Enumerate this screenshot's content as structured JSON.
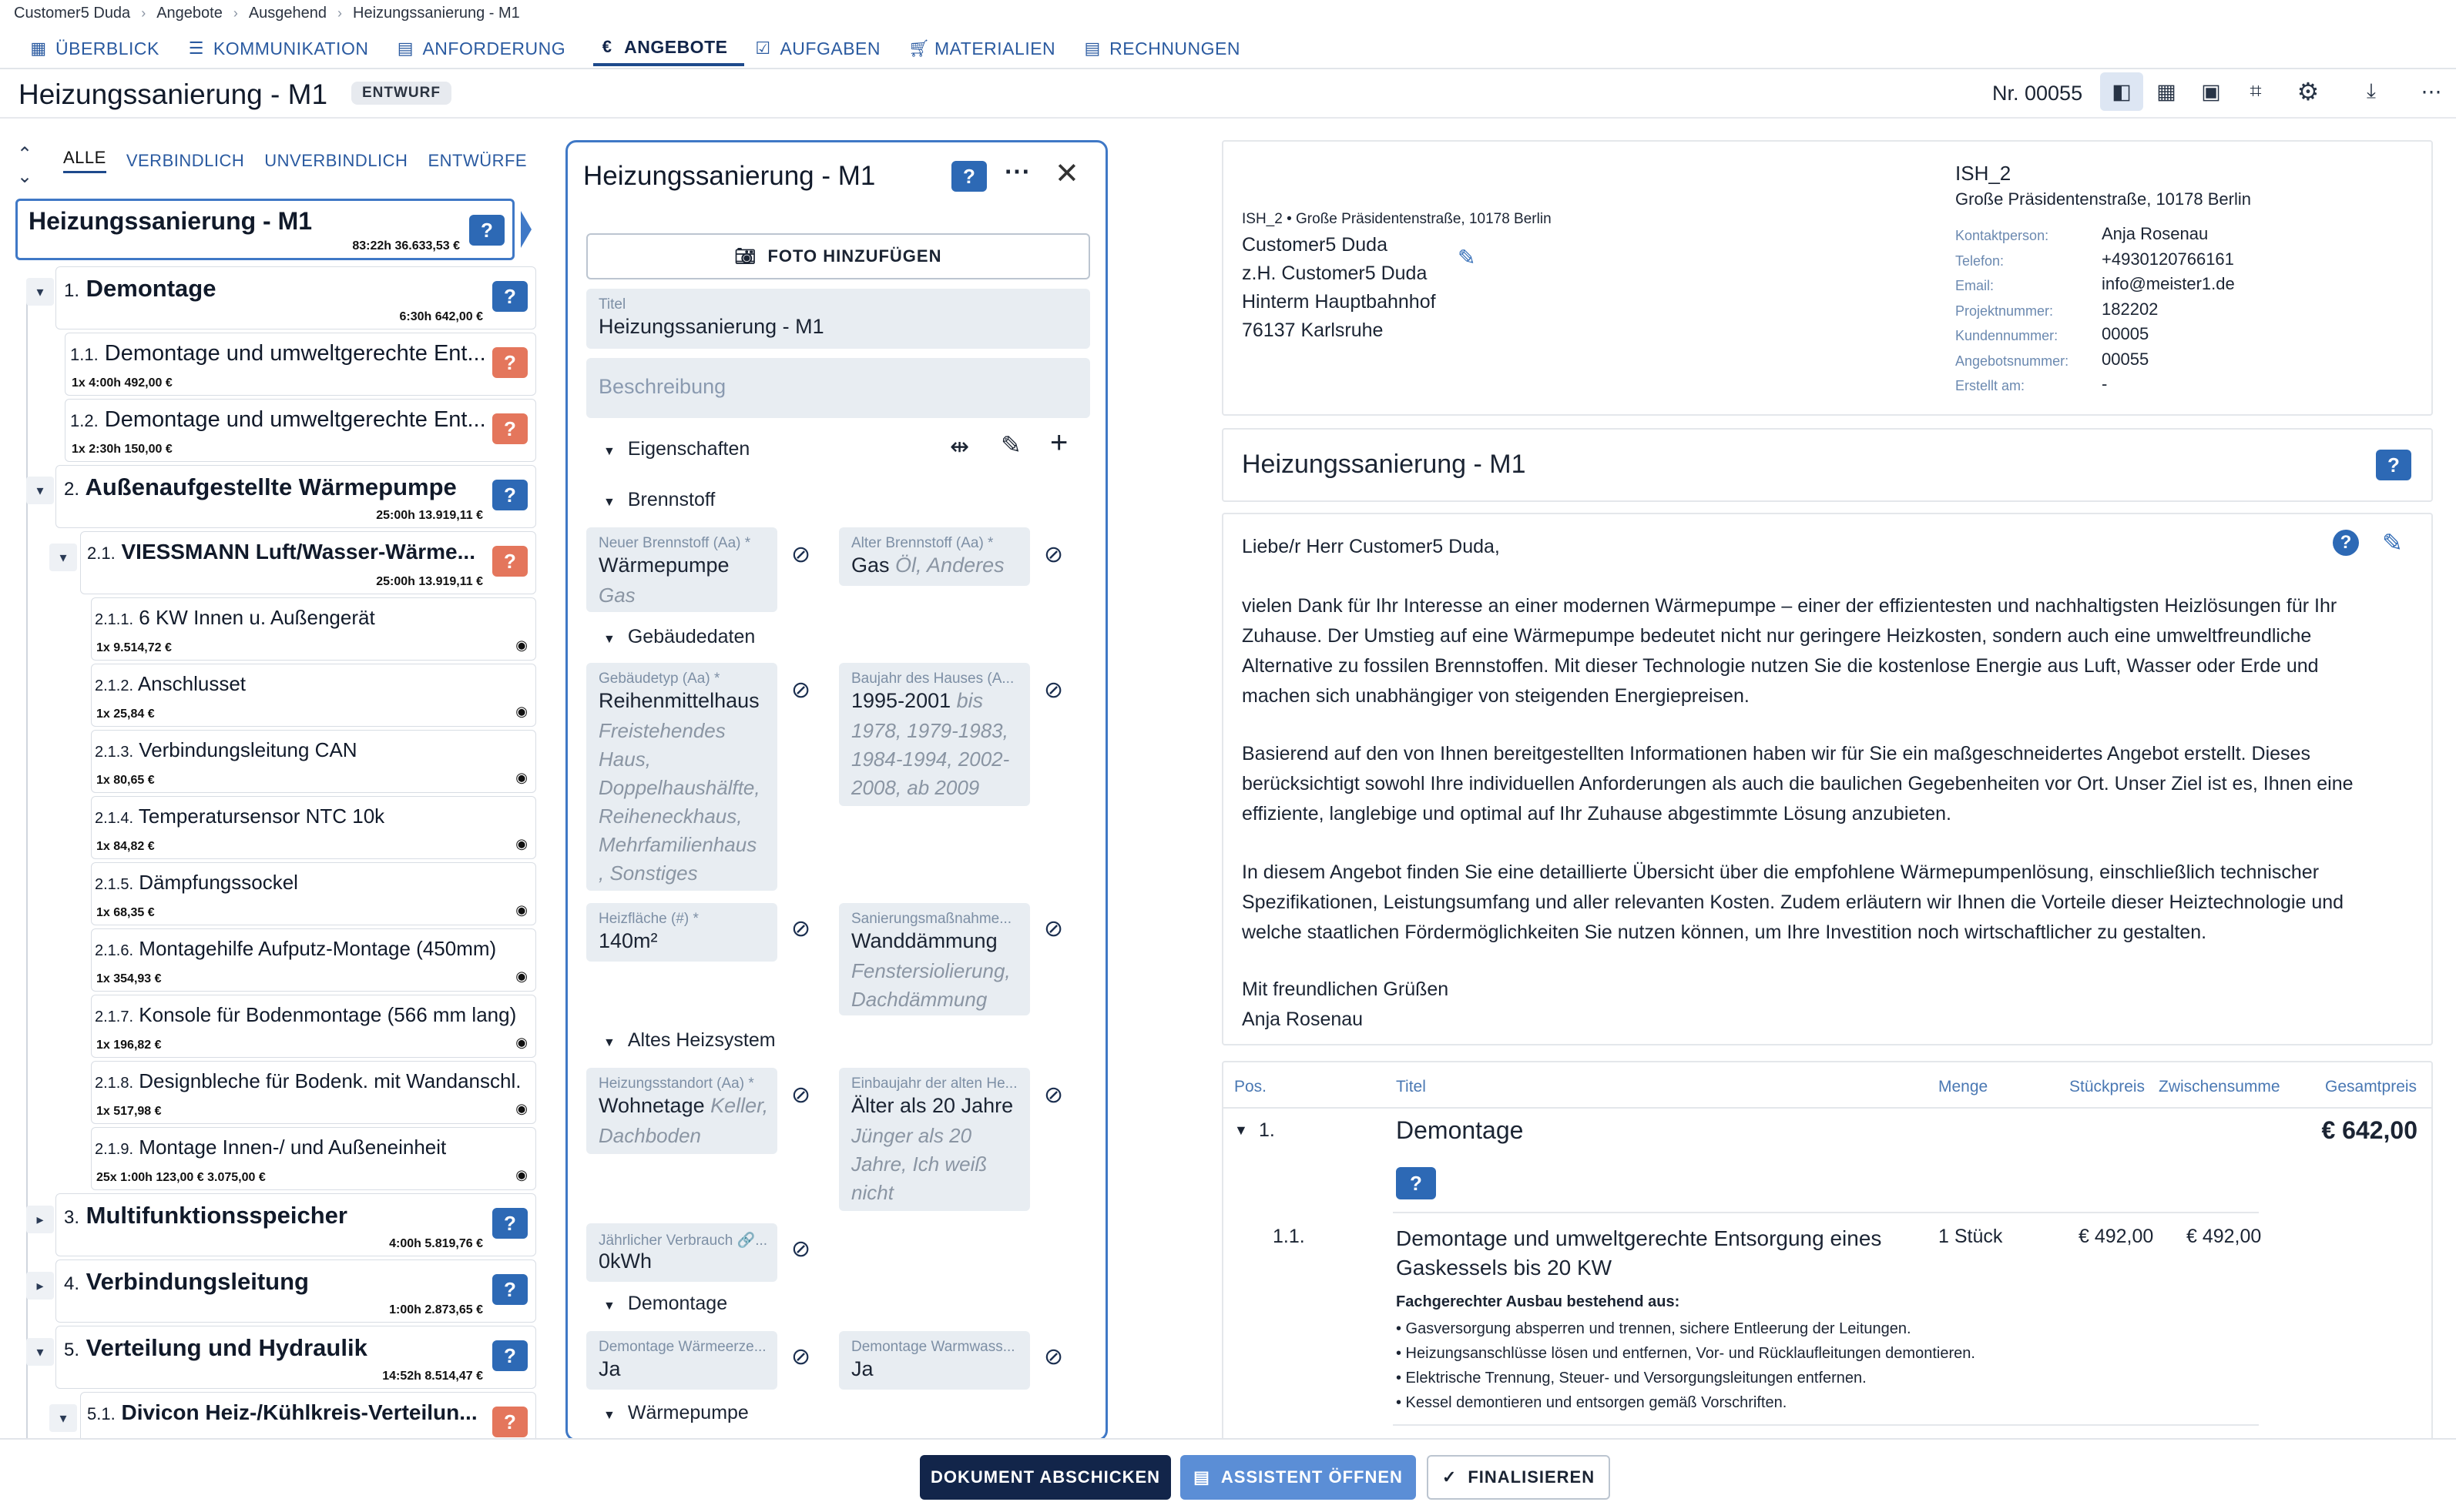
{
  "breadcrumb": [
    "Customer5 Duda",
    "Angebote",
    "Ausgehend",
    "Heizungssanierung - M1"
  ],
  "tabs": [
    {
      "label": "ÜBERBLICK",
      "icon": "grid-icon"
    },
    {
      "label": "KOMMUNIKATION",
      "icon": "chat-icon"
    },
    {
      "label": "ANFORDERUNG",
      "icon": "clipboard-icon"
    },
    {
      "label": "ANGEBOTE",
      "icon": "euro-icon"
    },
    {
      "label": "AUFGABEN",
      "icon": "checkbox-icon"
    },
    {
      "label": "MATERIALIEN",
      "icon": "cart-icon"
    },
    {
      "label": "RECHNUNGEN",
      "icon": "list-icon"
    }
  ],
  "header": {
    "title": "Heizungssanierung - M1",
    "status": "ENTWURF",
    "number": "Nr. 00055"
  },
  "filters": [
    "ALLE",
    "VERBINDLICH",
    "UNVERBINDLICH",
    "ENTWÜRFE"
  ],
  "tree": {
    "root": {
      "title": "Heizungssanierung - M1",
      "meta": "83:22h  36.633,53 €"
    },
    "n1": {
      "num": "1.",
      "title": "Demontage",
      "meta": "6:30h  642,00 €"
    },
    "n11": {
      "num": "1.1.",
      "title": "Demontage und umweltgerechte Ent...",
      "meta": "1x  4:00h  492,00 €"
    },
    "n12": {
      "num": "1.2.",
      "title": "Demontage und umweltgerechte Ent...",
      "meta": "1x  2:30h  150,00 €"
    },
    "n2": {
      "num": "2.",
      "title": "Außenaufgestellte Wärmepumpe",
      "meta": "25:00h  13.919,11 €"
    },
    "n21": {
      "num": "2.1.",
      "title": "VIESSMANN Luft/Wasser-Wärme...",
      "meta": "25:00h  13.919,11 €"
    },
    "subs": [
      {
        "num": "2.1.1.",
        "title": "6 KW Innen u. Außengerät",
        "meta": "1x  9.514,72 €"
      },
      {
        "num": "2.1.2.",
        "title": "Anschlusset",
        "meta": "1x  25,84 €"
      },
      {
        "num": "2.1.3.",
        "title": "Verbindungsleitung CAN",
        "meta": "1x  80,65 €"
      },
      {
        "num": "2.1.4.",
        "title": "Temperatursensor NTC 10k",
        "meta": "1x  84,82 €"
      },
      {
        "num": "2.1.5.",
        "title": "Dämpfungssockel",
        "meta": "1x  68,35 €"
      },
      {
        "num": "2.1.6.",
        "title": "Montagehilfe Aufputz-Montage (450mm)",
        "meta": "1x  354,93 €"
      },
      {
        "num": "2.1.7.",
        "title": "Konsole für Bodenmontage (566 mm lang)",
        "meta": "1x  196,82 €"
      },
      {
        "num": "2.1.8.",
        "title": "Designbleche für Bodenk. mit Wandanschl.",
        "meta": "1x  517,98 €"
      },
      {
        "num": "2.1.9.",
        "title": "Montage Innen-/ und Außeneinheit",
        "meta": "25x  1:00h  123,00 €  3.075,00 €"
      }
    ],
    "n3": {
      "num": "3.",
      "title": "Multifunktionsspeicher",
      "meta": "4:00h  5.819,76 €"
    },
    "n4": {
      "num": "4.",
      "title": "Verbindungsleitung",
      "meta": "1:00h  2.873,65 €"
    },
    "n5": {
      "num": "5.",
      "title": "Verteilung und Hydraulik",
      "meta": "14:52h  8.514,47 €"
    },
    "n51": {
      "num": "5.1.",
      "title": "Divicon Heiz-/Kühlkreis-Verteilun..."
    }
  },
  "editor": {
    "title": "Heizungssanierung - M1",
    "photo_button": "FOTO HINZUFÜGEN",
    "title_label": "Titel",
    "title_value": "Heizungssanierung - M1",
    "description_placeholder": "Beschreibung",
    "properties_label": "Eigenschaften",
    "sec_brennstoff": "Brennstoff",
    "new_fuel": {
      "label": "Neuer Brennstoff (Aa) *",
      "value": "Wärmepumpe",
      "options": [
        "Gas"
      ]
    },
    "old_fuel": {
      "label": "Alter Brennstoff (Aa) *",
      "value": "Gas",
      "options_inline": "Öl, Anderes"
    },
    "sec_gebaeude": "Gebäudedaten",
    "building_type": {
      "label": "Gebäudetyp (Aa) *",
      "value": "Reihenmittelhaus",
      "options": [
        "Freistehendes",
        "Haus,",
        "Doppelhaushälfte,",
        "Reiheneckhaus,",
        "Mehrfamilienhaus",
        ", Sonstiges"
      ]
    },
    "year_built": {
      "label": "Baujahr des Hauses (A...",
      "value": "1995-2001",
      "value_suffix": "bis",
      "options": [
        "1978, 1979-1983,",
        "1984-1994, 2002-",
        "2008, ab 2009"
      ]
    },
    "heated_area": {
      "label": "Heizfläche (#) *",
      "value": "140m²"
    },
    "renovation": {
      "label": "Sanierungsmaßnahme...",
      "value": "Wanddämmung",
      "options": [
        "Fenstersiolierung,",
        "Dachdämmung"
      ]
    },
    "sec_altes": "Altes Heizsystem",
    "heating_location": {
      "label": "Heizungsstandort (Aa) *",
      "value": "Wohnetage",
      "value_suffix": "Keller,",
      "options": [
        "Dachboden"
      ]
    },
    "install_year": {
      "label": "Einbaujahr der alten He...",
      "value": "Älter als 20 Jahre",
      "options": [
        "Jünger als 20",
        "Jahre, Ich weiß",
        "nicht"
      ]
    },
    "annual": {
      "label": "Jährlicher Verbrauch 🔗...",
      "value": "0kWh"
    },
    "sec_demontage": "Demontage",
    "dem_heat": {
      "label": "Demontage Wärmeerze...",
      "value": "Ja"
    },
    "dem_water": {
      "label": "Demontage Warmwass...",
      "value": "Ja"
    },
    "sec_wp": "Wärmepumpe"
  },
  "preview": {
    "sender_line": "ISH_2 • Große Präsidentenstraße, 10178 Berlin",
    "recipient": [
      "Customer5 Duda",
      "z.H. Customer5 Duda",
      "Hinterm Hauptbahnhof",
      "76137 Karlsruhe"
    ],
    "company": "ISH_2",
    "company_address": "Große Präsidentenstraße, 10178 Berlin",
    "info": [
      {
        "k": "Kontaktperson:",
        "v": "Anja Rosenau"
      },
      {
        "k": "Telefon:",
        "v": "+4930120766161"
      },
      {
        "k": "Email:",
        "v": "info@meister1.de"
      },
      {
        "k": "Projektnummer:",
        "v": "182202"
      },
      {
        "k": "Kundennummer:",
        "v": "00005"
      },
      {
        "k": "Angebotsnummer:",
        "v": "00055"
      },
      {
        "k": "Erstellt am:",
        "v": "-"
      }
    ],
    "doc_title": "Heizungssanierung - M1",
    "salutation": "Liebe/r Herr Customer5 Duda,",
    "p1": [
      "vielen Dank für Ihr Interesse an einer modernen Wärmepumpe – einer der effizientesten und nachhaltigsten Heizlösungen für Ihr",
      "Zuhause. Der Umstieg auf eine Wärmepumpe bedeutet nicht nur geringere Heizkosten, sondern auch eine umweltfreundliche",
      "Alternative zu fossilen Brennstoffen. Mit dieser Technologie nutzen Sie die kostenlose Energie aus Luft, Wasser oder Erde und",
      "machen sich unabhängiger von steigenden Energiepreisen."
    ],
    "p2": [
      "Basierend auf den von Ihnen bereitgestellten Informationen haben wir für Sie ein maßgeschneidertes Angebot erstellt. Dieses",
      "berücksichtigt sowohl Ihre individuellen Anforderungen als auch die baulichen Gegebenheiten vor Ort. Unser Ziel ist es, Ihnen eine",
      "effiziente, langlebige und optimal auf Ihr Zuhause abgestimmte Lösung anzubieten."
    ],
    "p3": [
      "In diesem Angebot finden Sie eine detaillierte Übersicht über die empfohlene Wärmepumpenlösung, einschließlich technischer",
      "Spezifikationen, Leistungsumfang und aller relevanten Kosten. Zudem erläutern wir Ihnen die Vorteile dieser Heiztechnologie und",
      "welche staatlichen Fördermöglichkeiten Sie nutzen können, um Ihre Investition noch wirtschaftlicher zu gestalten."
    ],
    "closing": "Mit freundlichen Grüßen",
    "signer": "Anja Rosenau",
    "table_headers": {
      "pos": "Pos.",
      "title": "Titel",
      "qty": "Menge",
      "unit": "Stückpreis",
      "subtotal": "Zwischensumme",
      "total": "Gesamtpreis"
    },
    "row1": {
      "pos": "1.",
      "title": "Demontage",
      "total": "€ 642,00"
    },
    "row11": {
      "pos": "1.1.",
      "title": [
        "Demontage und umweltgerechte Entsorgung eines",
        "Gaskessels bis 20 KW"
      ],
      "qty": "1 Stück",
      "unit": "€ 492,00",
      "subtotal": "€ 492,00"
    },
    "desc_head": "Fachgerechter Ausbau bestehend aus:",
    "desc": [
      "• Gasversorgung absperren und trennen, sichere Entleerung der Leitungen.",
      "• Heizungsanschlüsse lösen und entfernen, Vor- und Rücklaufleitungen demontieren.",
      "• Elektrische Trennung, Steuer- und Versorgungsleitungen entfernen.",
      "• Kessel demontieren und entsorgen gemäß Vorschriften."
    ]
  },
  "actions": {
    "send": "DOKUMENT ABSCHICKEN",
    "assistant": "ASSISTENT ÖFFNEN",
    "finalize": "FINALISIEREN"
  },
  "colors": {
    "primary": "#2d69b5",
    "dark": "#12254a",
    "warn": "#e4765c",
    "field": "#e8edf2"
  }
}
